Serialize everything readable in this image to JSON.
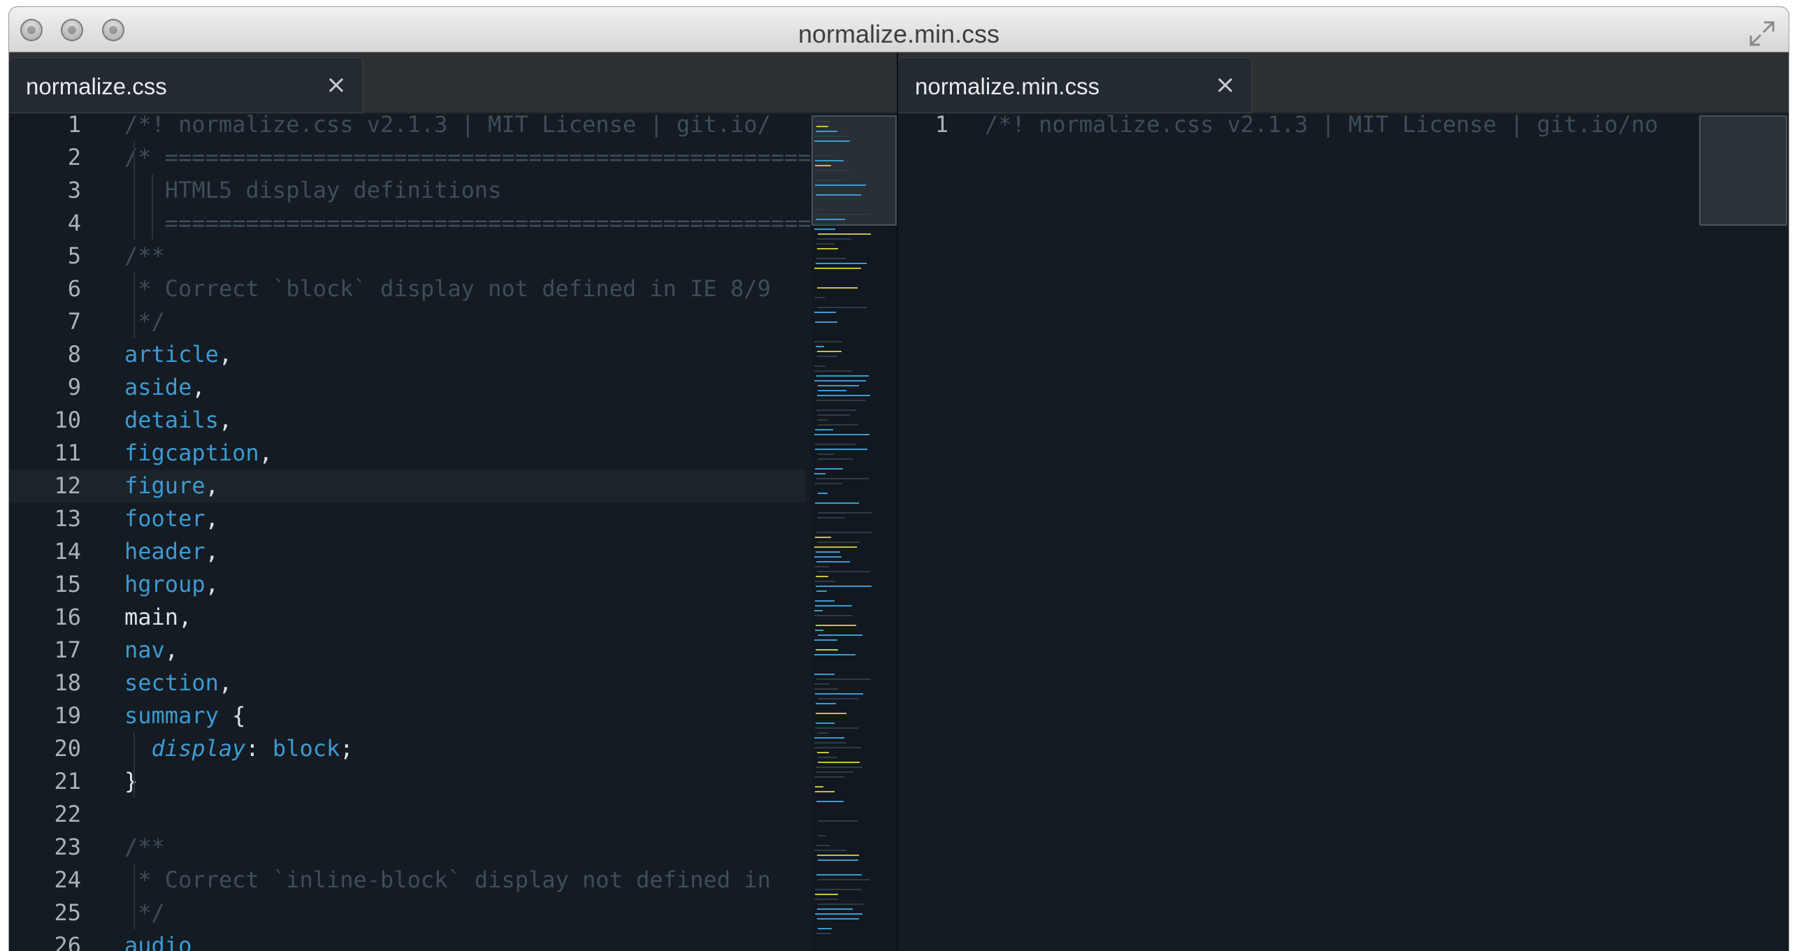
{
  "window": {
    "title": "normalize.min.css"
  },
  "left_pane": {
    "tab_label": "normalize.css",
    "tab_close": "×",
    "lines": [
      {
        "n": "1",
        "segs": [
          {
            "t": "/*! normalize.css v2.1.3 | MIT License | git.io/",
            "k": "c"
          }
        ]
      },
      {
        "n": "2",
        "segs": [
          {
            "t": "/* ==========================================================",
            "k": "c"
          }
        ]
      },
      {
        "n": "3",
        "segs": [
          {
            "t": "   HTML5 display definitions",
            "k": "c"
          }
        ]
      },
      {
        "n": "4",
        "segs": [
          {
            "t": "   ==========================================================",
            "k": "c"
          }
        ]
      },
      {
        "n": "5",
        "segs": [
          {
            "t": "/**",
            "k": "c"
          }
        ]
      },
      {
        "n": "6",
        "segs": [
          {
            "t": " * Correct `block` display not defined in IE 8/9",
            "k": "c"
          }
        ]
      },
      {
        "n": "7",
        "segs": [
          {
            "t": " */",
            "k": "c"
          }
        ]
      },
      {
        "n": "8",
        "segs": [
          {
            "t": "article",
            "k": "sel"
          },
          {
            "t": ",",
            "k": "pl"
          }
        ]
      },
      {
        "n": "9",
        "segs": [
          {
            "t": "aside",
            "k": "sel"
          },
          {
            "t": ",",
            "k": "pl"
          }
        ]
      },
      {
        "n": "10",
        "segs": [
          {
            "t": "details",
            "k": "sel"
          },
          {
            "t": ",",
            "k": "pl"
          }
        ]
      },
      {
        "n": "11",
        "segs": [
          {
            "t": "figcaption",
            "k": "sel"
          },
          {
            "t": ",",
            "k": "pl"
          }
        ]
      },
      {
        "n": "12",
        "segs": [
          {
            "t": "figure",
            "k": "sel"
          },
          {
            "t": ",",
            "k": "pl"
          }
        ]
      },
      {
        "n": "13",
        "segs": [
          {
            "t": "footer",
            "k": "sel"
          },
          {
            "t": ",",
            "k": "pl"
          }
        ]
      },
      {
        "n": "14",
        "segs": [
          {
            "t": "header",
            "k": "sel"
          },
          {
            "t": ",",
            "k": "pl"
          }
        ]
      },
      {
        "n": "15",
        "segs": [
          {
            "t": "hgroup",
            "k": "sel"
          },
          {
            "t": ",",
            "k": "pl"
          }
        ]
      },
      {
        "n": "16",
        "segs": [
          {
            "t": "main,",
            "k": "pl"
          }
        ]
      },
      {
        "n": "17",
        "segs": [
          {
            "t": "nav",
            "k": "sel"
          },
          {
            "t": ",",
            "k": "pl"
          }
        ]
      },
      {
        "n": "18",
        "segs": [
          {
            "t": "section",
            "k": "sel"
          },
          {
            "t": ",",
            "k": "pl"
          }
        ]
      },
      {
        "n": "19",
        "segs": [
          {
            "t": "summary",
            "k": "sel"
          },
          {
            "t": " {",
            "k": "pl"
          }
        ]
      },
      {
        "n": "20",
        "segs": [
          {
            "t": "  ",
            "k": "pl"
          },
          {
            "t": "display",
            "k": "prop"
          },
          {
            "t": ": ",
            "k": "pl"
          },
          {
            "t": "block",
            "k": "val"
          },
          {
            "t": ";",
            "k": "pl"
          }
        ]
      },
      {
        "n": "21",
        "segs": [
          {
            "t": "}",
            "k": "pl"
          }
        ]
      },
      {
        "n": "22",
        "segs": []
      },
      {
        "n": "23",
        "segs": [
          {
            "t": "/**",
            "k": "c"
          }
        ]
      },
      {
        "n": "24",
        "segs": [
          {
            "t": " * Correct `inline-block` display not defined in",
            "k": "c"
          }
        ]
      },
      {
        "n": "25",
        "segs": [
          {
            "t": " */",
            "k": "c"
          }
        ]
      },
      {
        "n": "26",
        "segs": [
          {
            "t": "audio",
            "k": "sel"
          }
        ]
      }
    ],
    "current_line": "12"
  },
  "right_pane": {
    "tab_label": "normalize.min.css",
    "tab_close": "×",
    "lines": [
      {
        "n": "1",
        "segs": [
          {
            "t": "/*! normalize.css v2.1.3 | MIT License | git.io/no",
            "k": "c"
          }
        ]
      }
    ]
  },
  "colors": {
    "background": "#141b22",
    "comment": "#3e4d5a",
    "selector": "#3d9ad1",
    "plain": "#dde3e8",
    "line_number": "#a9b2bb"
  }
}
